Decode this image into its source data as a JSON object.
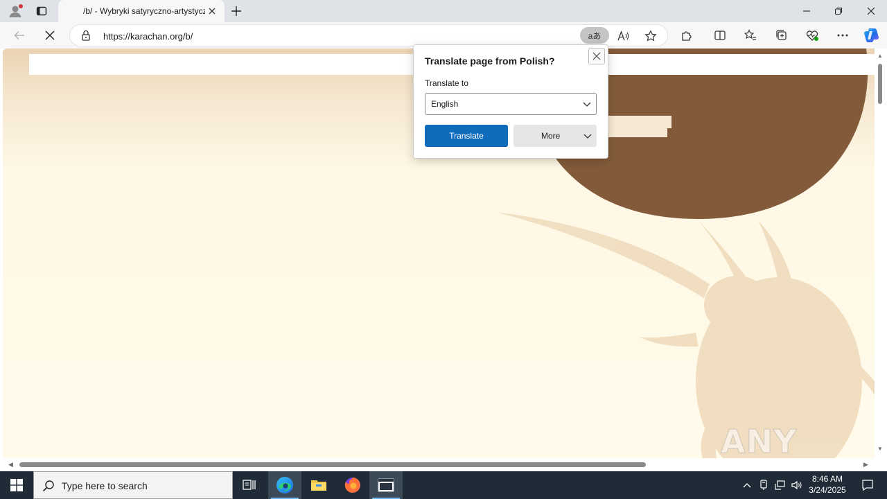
{
  "browser": {
    "tab": {
      "title": "/b/ - Wybryki satyryczno-artystyczne"
    },
    "address_bar": {
      "url": "https://karachan.org/b/",
      "translate_chip": "aあ"
    }
  },
  "translate_popup": {
    "title": "Translate page from Polish?",
    "target_label": "Translate to",
    "target_value": "English",
    "translate_button": "Translate",
    "more_button": "More"
  },
  "watermark": {
    "text": "ANY RUN"
  },
  "taskbar": {
    "search_placeholder": "Type here to search",
    "clock": {
      "time": "8:46 AM",
      "date": "3/24/2025"
    }
  },
  "colors": {
    "accent_blue": "#0f6cbd",
    "page_brown": "#835b3a",
    "taskbar": "#1f2b36"
  }
}
